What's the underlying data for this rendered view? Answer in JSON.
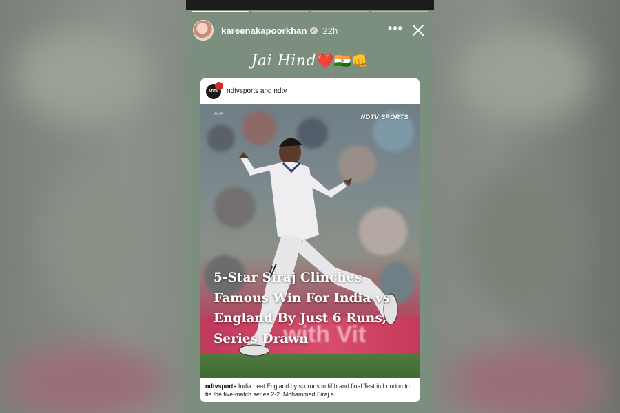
{
  "story": {
    "username": "kareenakapoorkhan",
    "verified_symbol": "✓",
    "time_ago": "22h",
    "more_symbol": "•••",
    "caption_text": "Jai Hind",
    "caption_emojis": "❤️🇮🇳👊",
    "progress_segments": 4,
    "progress_done": 1
  },
  "post": {
    "authors": "ndtvsports and ndtv",
    "avatar_text": "NDTV",
    "image_credit": "AFP",
    "watermark": "NDTV SPORTS",
    "headline": "5-Star Siraj Clinches Famous Win For India vs England By Just 6 Runs, Series Drawn",
    "banner_text": "with Vit",
    "caption_user": "ndtvsports",
    "caption_text": "India beat England by six runs in fifth and final Test in London to tie the five-match series 2-2. Mohammed Siraj e..."
  },
  "colors": {
    "story_bg": "#7c8f7f",
    "card_bg": "#ffffff",
    "banner": "#d94b6b"
  },
  "icons": [
    "verified-badge-icon",
    "more-options-icon",
    "close-icon"
  ]
}
